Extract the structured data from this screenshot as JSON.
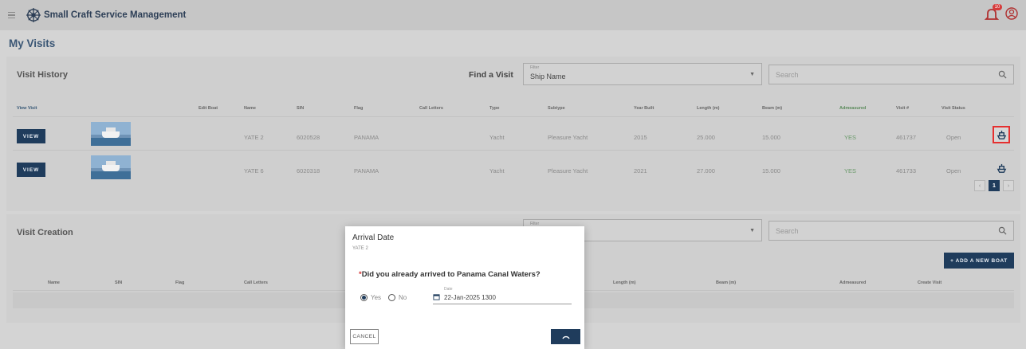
{
  "app": {
    "title": "Small Craft Service Management",
    "notification_count": "10"
  },
  "page_title": "My Visits",
  "visit_history": {
    "title": "Visit History",
    "find_label": "Find a Visit",
    "filter": {
      "label": "Filter",
      "value": "Ship Name"
    },
    "search_placeholder": "Search",
    "columns": [
      "View Visit",
      "Edit Boat",
      "Name",
      "SIN",
      "Flag",
      "Call Letters",
      "Type",
      "Subtype",
      "Year Built",
      "Length (m)",
      "Beam (m)",
      "Admeasured",
      "Visit #",
      "Visit Status"
    ],
    "rows": [
      {
        "view": "VIEW",
        "name": "YATE 2",
        "sin": "6020528",
        "flag": "PANAMA",
        "type": "Yacht",
        "subtype": "Pleasure Yacht",
        "year": "2015",
        "length": "25.000",
        "beam": "15.000",
        "admeasured": "YES",
        "visit": "461737",
        "status": "Open"
      },
      {
        "view": "VIEW",
        "name": "YATE 6",
        "sin": "6020318",
        "flag": "PANAMA",
        "type": "Yacht",
        "subtype": "Pleasure Yacht",
        "year": "2021",
        "length": "27.000",
        "beam": "15.000",
        "admeasured": "YES",
        "visit": "461733",
        "status": "Open"
      }
    ],
    "pagination": {
      "prev": "‹",
      "current": "1",
      "next": "›"
    }
  },
  "visit_creation": {
    "title": "Visit Creation",
    "filter_label": "Filter",
    "search_placeholder": "Search",
    "add_button": "+ ADD A NEW BOAT",
    "columns": [
      "Name",
      "SIN",
      "Flag",
      "Call Letters",
      "Length (m)",
      "Beam (m)",
      "Admeasured",
      "Create Visit"
    ]
  },
  "modal": {
    "title": "Arrival Date",
    "subtitle": "YATE 2",
    "required_mark": "*",
    "question": "Did you already arrived to Panama Canal Waters?",
    "yes_label": "Yes",
    "no_label": "No",
    "date_label": "Date",
    "date_value": "22-Jan-2025 1300",
    "cancel_label": "CANCEL"
  },
  "colors": {
    "primary": "#1f3c5c",
    "highlight": "#e53030",
    "badge": "#d63a3a"
  }
}
